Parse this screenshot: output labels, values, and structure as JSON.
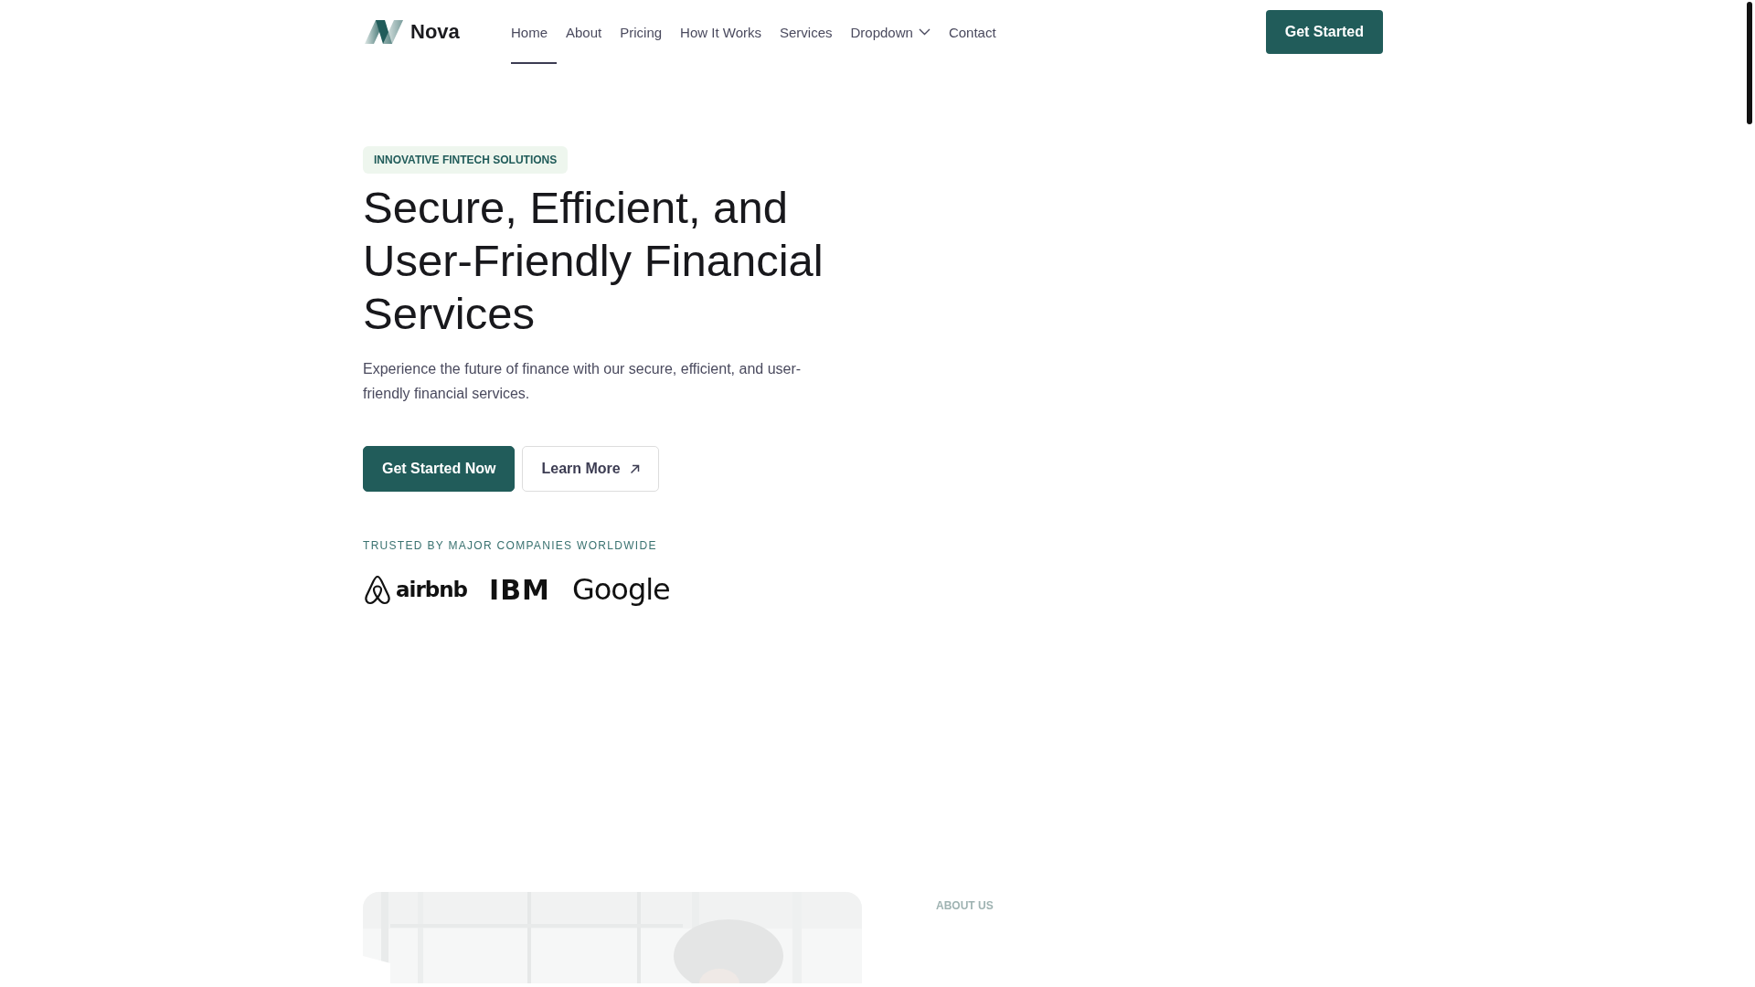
{
  "brand": {
    "name": "Nova"
  },
  "nav": [
    {
      "label": "Home",
      "selected": true,
      "kind": "link"
    },
    {
      "label": "About",
      "selected": false,
      "kind": "link"
    },
    {
      "label": "Pricing",
      "selected": false,
      "kind": "link"
    },
    {
      "label": "How It Works",
      "selected": false,
      "kind": "link"
    },
    {
      "label": "Services",
      "selected": false,
      "kind": "link"
    },
    {
      "label": "Dropdown",
      "selected": false,
      "kind": "dropdown"
    },
    {
      "label": "Contact",
      "selected": false,
      "kind": "link"
    }
  ],
  "header_button": "Get Started",
  "hero": {
    "badge": "INNOVATIVE FINTECH SOLUTIONS",
    "title": "Secure, Efficient, and User-Friendly Financial Services",
    "text": "Experience the future of finance with our secure, efficient, and user-friendly financial services.",
    "buttons": [
      {
        "label": "Get Started Now",
        "kind": "primary"
      },
      {
        "label": "Learn More",
        "kind": "outline"
      }
    ],
    "trusted": "TRUSTED BY MAJOR COMPANIES WORLDWIDE",
    "logos": [
      {
        "name": "airbnb",
        "kind": "airbnb"
      },
      {
        "name": "IBM",
        "kind": "ibm"
      },
      {
        "name": "Google",
        "kind": "google"
      }
    ]
  },
  "about": {
    "label": "ABOUT US"
  }
}
